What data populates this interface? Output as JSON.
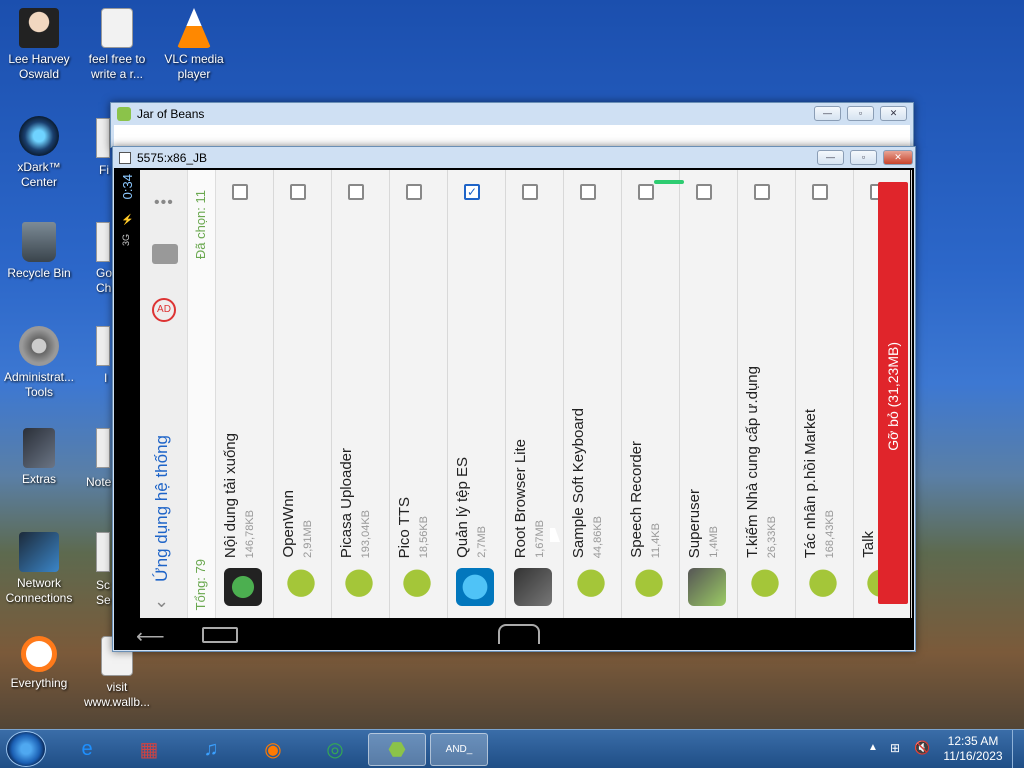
{
  "desktop": {
    "icons": [
      {
        "label": "Lee Harvey Oswald",
        "icon": "person-icon"
      },
      {
        "label": "feel free to write a r...",
        "icon": "document-icon"
      },
      {
        "label": "VLC media player",
        "icon": "vlc-icon"
      },
      {
        "label": "xDark™ Center",
        "icon": "xdark-icon"
      },
      {
        "label": "Recycle Bin",
        "icon": "recycle-bin-icon"
      },
      {
        "label": "Administrat... Tools",
        "icon": "admin-tools-icon"
      },
      {
        "label": "Extras",
        "icon": "folder-icon"
      },
      {
        "label": "Network Connections",
        "icon": "network-icon"
      },
      {
        "label": "Everything",
        "icon": "search-icon"
      },
      {
        "label": "visit www.wallb...",
        "icon": "document-icon"
      }
    ],
    "partial_labels": [
      "Fi",
      "Go Ch",
      "I",
      "Note",
      "Sc Se"
    ]
  },
  "outer_window": {
    "title": "Jar of Beans"
  },
  "inner_window": {
    "title": "5575:x86_JB"
  },
  "android": {
    "status_time": "0:34",
    "signal": "3G",
    "header_title": "Ứng dụng hệ thống",
    "total_label": "Tổng: 79",
    "selected_label": "Đã chọn: 11",
    "uninstall_button": "Gỡ bỏ (31,23MB)",
    "apps": [
      {
        "name": "Nội dung tải xuống",
        "size": "146,78KB",
        "checked": false,
        "icon": "download-icon"
      },
      {
        "name": "OpenWnn",
        "size": "2,91MB",
        "checked": false,
        "icon": "android-icon"
      },
      {
        "name": "Picasa Uploader",
        "size": "193,04KB",
        "checked": false,
        "icon": "android-icon"
      },
      {
        "name": "Pico TTS",
        "size": "18,56KB",
        "checked": false,
        "icon": "android-icon"
      },
      {
        "name": "Quản lý tệp ES",
        "size": "2,7MB",
        "checked": true,
        "icon": "es-file-icon"
      },
      {
        "name": "Root Browser Lite",
        "size": "1,67MB",
        "checked": false,
        "icon": "root-browser-icon"
      },
      {
        "name": "Sample Soft Keyboard",
        "size": "44,86KB",
        "checked": false,
        "icon": "android-icon"
      },
      {
        "name": "Speech Recorder",
        "size": "11,4KB",
        "checked": false,
        "icon": "android-icon"
      },
      {
        "name": "Superuser",
        "size": "1,4MB",
        "checked": false,
        "icon": "superuser-icon"
      },
      {
        "name": "T.kiếm Nhà cung cấp ư.dụng",
        "size": "26,33KB",
        "checked": false,
        "icon": "android-icon"
      },
      {
        "name": "Tác nhân p.hồi Market",
        "size": "168,43KB",
        "checked": false,
        "icon": "android-icon"
      },
      {
        "name": "Talk",
        "size": "",
        "checked": false,
        "icon": "android-icon"
      }
    ]
  },
  "taskbar": {
    "time": "12:35 AM",
    "date": "11/16/2023",
    "items": [
      "start-button",
      "internet-explorer-icon",
      "app-icon",
      "music-icon",
      "firefox-icon",
      "chrome-icon",
      "jar-of-beans-icon",
      "android-emulator-icon"
    ]
  },
  "colors": {
    "accent_red": "#e0252b",
    "android_green": "#a4c639",
    "total_green": "#6aa84f"
  }
}
